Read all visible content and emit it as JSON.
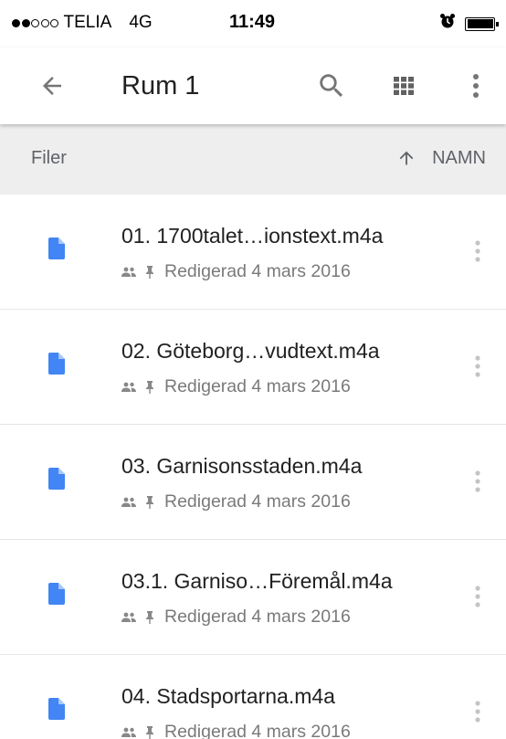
{
  "status_bar": {
    "carrier": "TELIA",
    "network": "4G",
    "time": "11:49",
    "signal_bars_filled": 2,
    "signal_bars_total": 5,
    "alarm_icon": "alarm-clock-icon",
    "battery_icon": "battery-full-icon"
  },
  "app_bar": {
    "title": "Rum 1",
    "back_icon": "arrow-back-icon",
    "search_icon": "search-icon",
    "grid_icon": "grid-view-icon",
    "more_icon": "more-vert-icon"
  },
  "sort_header": {
    "section_label": "Filer",
    "sort_label": "NAMN",
    "sort_icon": "arrow-up-icon"
  },
  "colors": {
    "file_icon_blue": "#4285F4",
    "header_bg": "#EEEEEE",
    "meta_gray": "#7A7A7A",
    "icon_gray": "#9E9E9E"
  },
  "files": [
    {
      "name": "01. 1700talet…ionstext.m4a",
      "meta": "Redigerad 4 mars 2016",
      "icon": "document-icon",
      "shared_icon": "shared-people-icon",
      "pin_icon": "pin-icon"
    },
    {
      "name": "02. Göteborg…vudtext.m4a",
      "meta": "Redigerad 4 mars 2016",
      "icon": "document-icon",
      "shared_icon": "shared-people-icon",
      "pin_icon": "pin-icon"
    },
    {
      "name": "03. Garnisonsstaden.m4a",
      "meta": "Redigerad 4 mars 2016",
      "icon": "document-icon",
      "shared_icon": "shared-people-icon",
      "pin_icon": "pin-icon"
    },
    {
      "name": "03.1. Garniso…Föremål.m4a",
      "meta": "Redigerad 4 mars 2016",
      "icon": "document-icon",
      "shared_icon": "shared-people-icon",
      "pin_icon": "pin-icon"
    },
    {
      "name": "04. Stadsportarna.m4a",
      "meta": "Redigerad 4 mars 2016",
      "icon": "document-icon",
      "shared_icon": "shared-people-icon",
      "pin_icon": "pin-icon"
    }
  ]
}
